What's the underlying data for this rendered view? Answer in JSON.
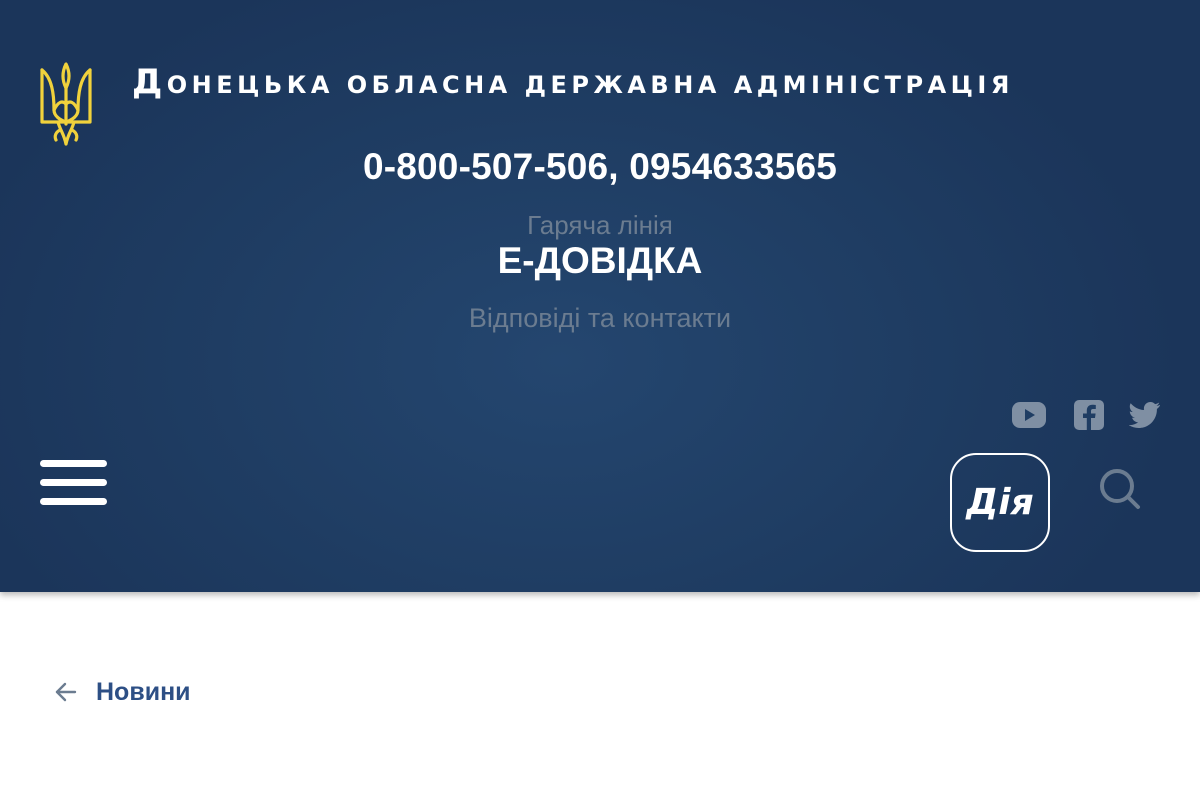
{
  "header": {
    "org_title_first": "Д",
    "org_title_rest": "онецька обласна державна адміністрація",
    "phone": "0-800-507-506, 0954633565",
    "hotline_label": "Гаряча лінія",
    "edovidka_title": "Е-ДОВІДКА",
    "edovidka_subtitle": "Відповіді та контакти",
    "diia_label": "Дія",
    "social_icons": [
      "youtube-icon",
      "facebook-icon",
      "twitter-icon"
    ]
  },
  "breadcrumb": {
    "label": "Новини"
  },
  "colors": {
    "header_bg": "#1f3d63",
    "coat_of_arms": "#f1d23c",
    "muted_text": "#6b7c90",
    "link": "#2d4f85"
  }
}
